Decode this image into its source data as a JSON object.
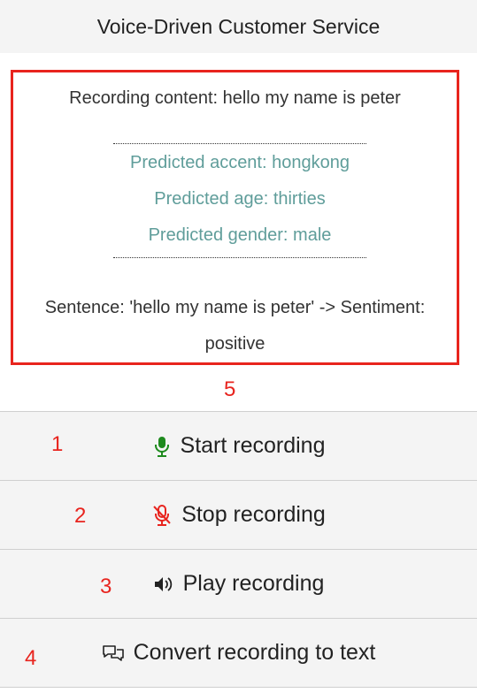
{
  "header": {
    "title": "Voice-Driven Customer Service"
  },
  "result": {
    "recording_content": "Recording content: hello my name is peter",
    "predicted_accent": "Predicted accent: hongkong",
    "predicted_age": "Predicted age: thirties",
    "predicted_gender": "Predicted gender: male",
    "sentiment": "Sentence: 'hello my name is peter' -> Sentiment: positive"
  },
  "annotations": {
    "result_box": "5",
    "start": "1",
    "stop": "2",
    "play": "3",
    "convert": "4"
  },
  "buttons": [
    {
      "label": "Start recording",
      "icon": "microphone-icon",
      "icon_color": "#1e8a1e"
    },
    {
      "label": "Stop recording",
      "icon": "microphone-slash-icon",
      "icon_color": "#e8241e"
    },
    {
      "label": "Play recording",
      "icon": "speaker-icon",
      "icon_color": "#222222"
    },
    {
      "label": "Convert recording to text",
      "icon": "chat-bubbles-icon",
      "icon_color": "#222222"
    }
  ],
  "colors": {
    "annotation": "#e8241e",
    "prediction_text": "#5f9d9a",
    "button_bg": "#f4f4f4"
  }
}
